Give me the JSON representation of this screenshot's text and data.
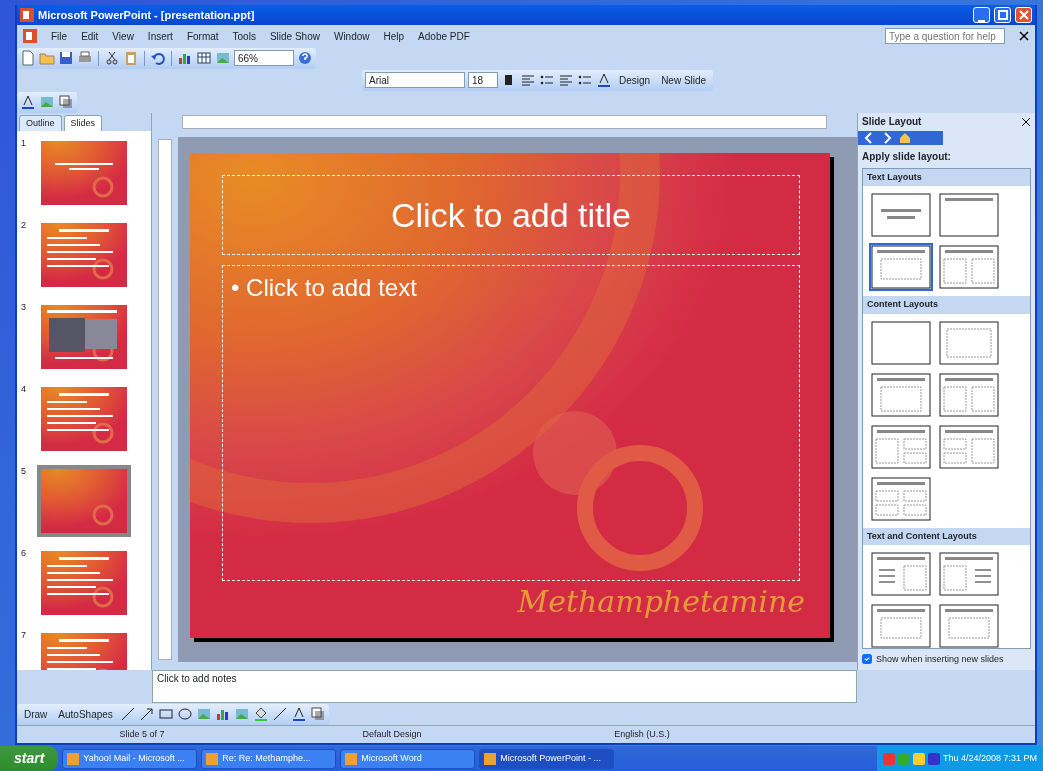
{
  "window": {
    "title": "Microsoft PowerPoint - [presentation.ppt]"
  },
  "menu": [
    "File",
    "Edit",
    "View",
    "Insert",
    "Format",
    "Tools",
    "Slide Show",
    "Window",
    "Help",
    "Adobe PDF"
  ],
  "help_box": {
    "placeholder": "Type a question for help"
  },
  "standard_toolbar": {
    "zoom": "66%"
  },
  "formatting_toolbar": {
    "font": "Arial",
    "size": "18",
    "buttons": [
      "Design",
      "New Slide"
    ]
  },
  "pane_tabs": [
    {
      "label": "Outline",
      "selected": false
    },
    {
      "label": "Slides",
      "selected": true
    }
  ],
  "slides": [
    {
      "number": "1",
      "kind": "title",
      "selected": false
    },
    {
      "number": "2",
      "kind": "text",
      "selected": false
    },
    {
      "number": "3",
      "kind": "photos",
      "selected": false
    },
    {
      "number": "4",
      "kind": "text",
      "selected": false
    },
    {
      "number": "5",
      "kind": "blank",
      "selected": true
    },
    {
      "number": "6",
      "kind": "text",
      "selected": false
    },
    {
      "number": "7",
      "kind": "text",
      "selected": false
    }
  ],
  "slide": {
    "title_placeholder": "Click to add title",
    "body_placeholder": "• Click to add text",
    "decorative_text": "Methamphetamine"
  },
  "notes": {
    "placeholder": "Click to add notes"
  },
  "task_pane": {
    "title": "Slide Layout",
    "apply_label": "Apply slide layout:",
    "sections": [
      {
        "heading": "Text Layouts",
        "layouts": [
          {
            "kind": "title-slide",
            "selected": false
          },
          {
            "kind": "title-only",
            "selected": false
          },
          {
            "kind": "title-text",
            "selected": true
          },
          {
            "kind": "two-column",
            "selected": false
          }
        ]
      },
      {
        "heading": "Content Layouts",
        "layouts": [
          {
            "kind": "blank",
            "selected": false
          },
          {
            "kind": "content",
            "selected": false
          },
          {
            "kind": "title-content",
            "selected": false
          },
          {
            "kind": "two-content",
            "selected": false
          },
          {
            "kind": "content-over-two",
            "selected": false
          },
          {
            "kind": "two-over-content",
            "selected": false
          },
          {
            "kind": "four-content",
            "selected": false
          }
        ]
      },
      {
        "heading": "Text and Content Layouts",
        "layouts": [
          {
            "kind": "text-content",
            "selected": false
          },
          {
            "kind": "content-text",
            "selected": false
          },
          {
            "kind": "title-text",
            "selected": false
          },
          {
            "kind": "title-text",
            "selected": false
          }
        ]
      }
    ],
    "show_when_inserting": {
      "label": "Show when inserting new slides",
      "checked": true
    }
  },
  "drawing_toolbar": {
    "draw": "Draw",
    "autoshapes": "AutoShapes"
  },
  "status_bar": [
    "Slide 5 of 7",
    "Default Design",
    "English (U.S.)"
  ],
  "taskbar": {
    "start": "start",
    "tasks": [
      {
        "label": "Yahoo! Mail - Microsoft ...",
        "selected": false
      },
      {
        "label": "Re: Re: Methamphe...",
        "selected": false
      },
      {
        "label": "Microsoft Word",
        "selected": false
      },
      {
        "label": "Microsoft PowerPoint - ...",
        "selected": true
      }
    ],
    "clock": "Thu 4/24/2008 7:31 PM"
  }
}
